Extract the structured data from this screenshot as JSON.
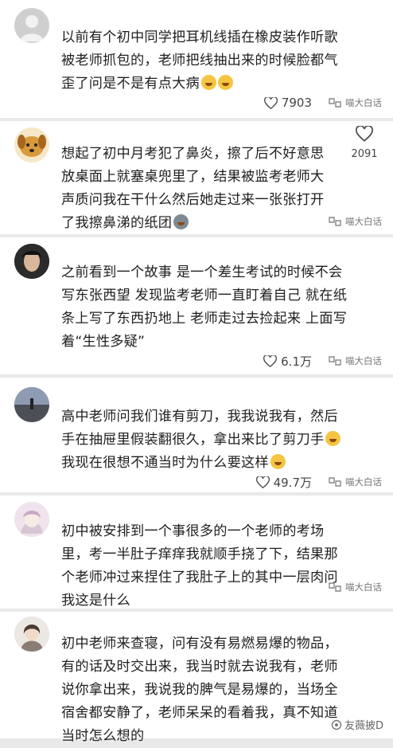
{
  "comments": [
    {
      "lines": [
        "以前有个初中同学把耳机线插在橡皮装作听歌",
        "被老师抓包的，老师把线抽出来的时候脸都气",
        "歪了问是不是有点大病"
      ],
      "emoji": "😂😂",
      "likes": "7903",
      "watermark": "喵大白话"
    },
    {
      "lines": [
        "想起了初中月考犯了鼻炎，擦了后不好意思",
        "放桌面上就塞桌兜里了，结果被监考老师大",
        "声质问我在干什么然后她走过来一张张打开",
        "了我擦鼻涕的纸团"
      ],
      "emoji": "😓",
      "likes": "2091",
      "watermark": "喵大白话"
    },
    {
      "lines": [
        "之前看到一个故事 是一个差生考试的时候不会",
        "写东张西望 发现监考老师一直盯着自己 就在纸",
        "条上写了东西扔地上 老师走过去捡起来 上面写",
        "着“生性多疑”"
      ],
      "emoji": "",
      "likes": "6.1万",
      "watermark": "喵大白话"
    },
    {
      "lines": [
        "高中老师问我们谁有剪刀，我我说我有，然后",
        "手在抽屉里假装翻很久，拿出来比了剪刀手",
        "我现在很想不通当时为什么要这样"
      ],
      "emoji": "😂",
      "likes": "49.7万",
      "watermark": "喵大白话"
    },
    {
      "lines": [
        "初中被安排到一个事很多的一个老师的考场",
        "里，考一半肚子痒痒我就顺手挠了下，结果那",
        "个老师冲过来捏住了我肚子上的其中一层肉问",
        "我这是什么"
      ],
      "emoji": "",
      "likes": "",
      "watermark": "喵大白话"
    },
    {
      "lines": [
        "初中老师来查寝，问有没有易燃易爆的物品，",
        "有的话及时交出来，我当时就去说我有，老师",
        "说你拿出来，我说我的脾气是易爆的，当场全",
        "宿舍都安静了，老师呆呆的看着我，真不知道",
        "当时怎么想的"
      ],
      "emoji": "",
      "likes": "",
      "watermark": "友薇披D"
    }
  ],
  "colors": {
    "background": "#e9e9e9",
    "card": "#ffffff",
    "text": "#1f1f1f",
    "meta": "#444444"
  }
}
